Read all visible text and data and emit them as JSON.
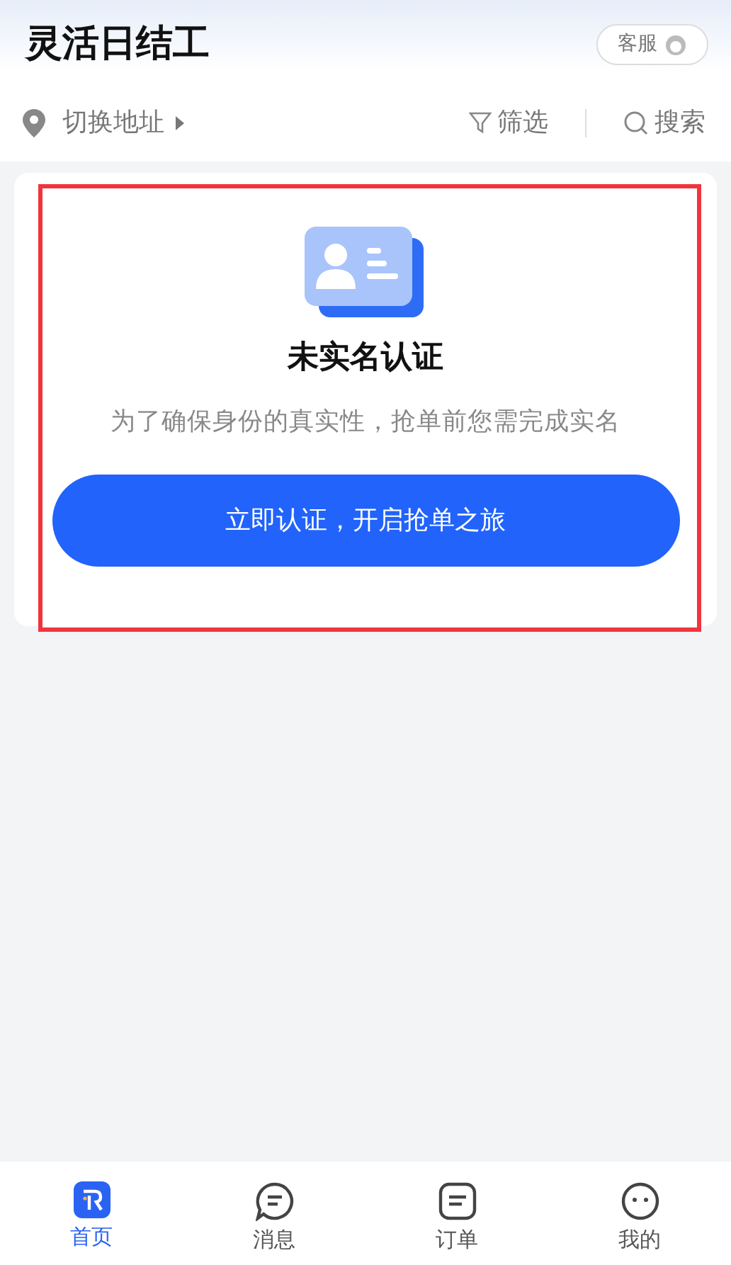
{
  "header": {
    "title": "灵活日结工",
    "service_button": "客服"
  },
  "toolbar": {
    "location": "切换地址",
    "filter": "筛选",
    "search": "搜索"
  },
  "verify_card": {
    "title": "未实名认证",
    "description": "为了确保身份的真实性，抢单前您需完成实名",
    "button": "立即认证，开启抢单之旅"
  },
  "tab_bar": [
    {
      "label": "首页",
      "kind": "home",
      "selected": true
    },
    {
      "label": "消息",
      "kind": "message",
      "selected": false
    },
    {
      "label": "订单",
      "kind": "order",
      "selected": false
    },
    {
      "label": "我的",
      "kind": "profile",
      "selected": false
    }
  ]
}
